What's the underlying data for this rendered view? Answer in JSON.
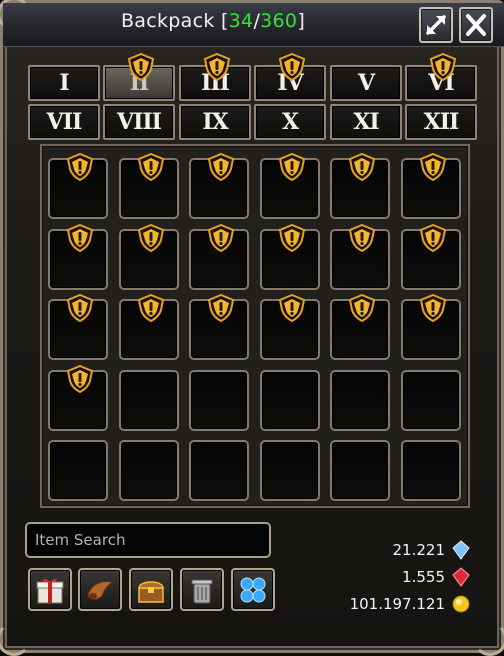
{
  "window": {
    "title_prefix": "Backpack [",
    "used": "34",
    "separator": "/",
    "capacity": "360",
    "title_suffix": "]"
  },
  "tabs": [
    {
      "label": "I",
      "warning": false,
      "active": false
    },
    {
      "label": "II",
      "warning": true,
      "active": true
    },
    {
      "label": "III",
      "warning": true,
      "active": false
    },
    {
      "label": "IV",
      "warning": true,
      "active": false
    },
    {
      "label": "V",
      "warning": false,
      "active": false
    },
    {
      "label": "VI",
      "warning": true,
      "active": false
    },
    {
      "label": "VII",
      "warning": false,
      "active": false
    },
    {
      "label": "VIII",
      "warning": false,
      "active": false
    },
    {
      "label": "IX",
      "warning": false,
      "active": false
    },
    {
      "label": "X",
      "warning": false,
      "active": false
    },
    {
      "label": "XI",
      "warning": false,
      "active": false
    },
    {
      "label": "XII",
      "warning": false,
      "active": false
    }
  ],
  "slots": [
    true,
    true,
    true,
    true,
    true,
    true,
    true,
    true,
    true,
    true,
    true,
    true,
    true,
    true,
    true,
    true,
    true,
    true,
    true,
    false,
    false,
    false,
    false,
    false,
    false,
    false,
    false,
    false,
    false,
    false
  ],
  "search": {
    "placeholder": "Item Search"
  },
  "tools": [
    {
      "icon": "gift-box-icon"
    },
    {
      "icon": "horn-icon"
    },
    {
      "icon": "treasure-chest-icon"
    },
    {
      "icon": "trash-can-icon"
    },
    {
      "icon": "blue-orbs-icon"
    }
  ],
  "currencies": [
    {
      "value": "21.221",
      "icon": "blue-crystal-icon",
      "color": "#7fc4ff"
    },
    {
      "value": "1.555",
      "icon": "red-crystal-icon",
      "color": "#e0283a"
    },
    {
      "value": "101.197.121",
      "icon": "gold-coin-icon",
      "color": "#f2c81e"
    }
  ],
  "colors": {
    "accent_green": "#35e23a",
    "warning_gold": "#e8a21a",
    "frame": "#8a8070"
  }
}
